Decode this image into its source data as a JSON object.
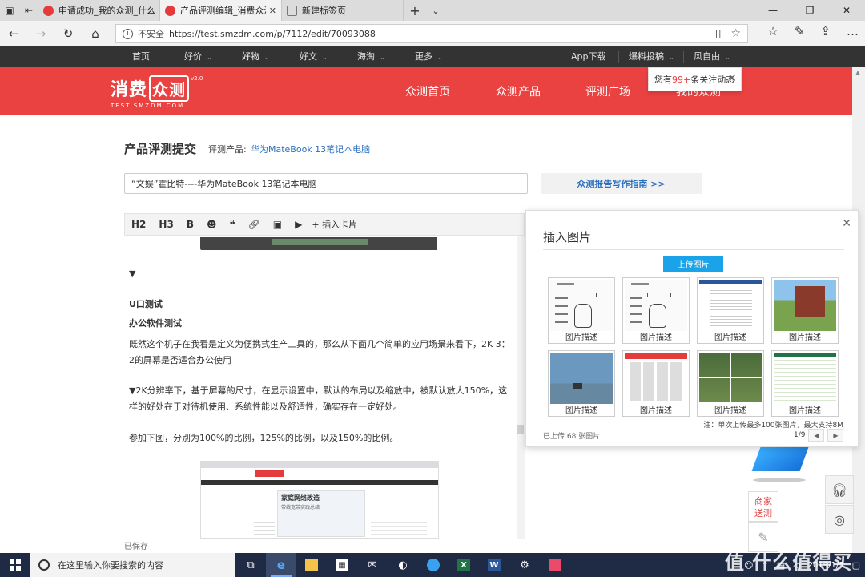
{
  "browser": {
    "tabs": [
      {
        "title": "申请成功_我的众测_什么值",
        "active": false
      },
      {
        "title": "产品评测编辑_消费众测",
        "active": true
      },
      {
        "title": "新建标签页",
        "active": false
      }
    ],
    "insecure_label": "不安全",
    "url": "https://test.smzdm.com/p/7112/edit/70093088"
  },
  "site_nav": {
    "items": [
      "首页",
      "好价",
      "好物",
      "好文",
      "海淘",
      "更多"
    ],
    "right_items": [
      "App下载",
      "爆料投稿",
      "风自由"
    ]
  },
  "hero": {
    "logo_text_a": "消费",
    "logo_text_b": "众测",
    "logo_version": "v2.0",
    "logo_sub": "TEST.SMZDM.COM",
    "nav": [
      "众测首页",
      "众测产品",
      "评测广场",
      "我的众测"
    ]
  },
  "notification": {
    "prefix": "您有",
    "count": "99+",
    "suffix": "条关注动态"
  },
  "page": {
    "heading": "产品评测提交",
    "product_label": "评测产品:",
    "product_name": "华为MateBook 13笔记本电脑",
    "title_value": "“文娱”霍比特----华为MateBook 13笔记本电脑",
    "guide_button": "众测报告写作指南 >>",
    "saved_status": "已保存"
  },
  "toolbar": {
    "h2": "H2",
    "h3": "H3",
    "bold": "B",
    "insert_card": "插入卡片"
  },
  "editor": {
    "arrow": "▼",
    "h_usb": "U口测试",
    "h_office": "办公软件测试",
    "p1": "既然这个机子在我看是定义为便携式生产工具的，那么从下面几个简单的应用场景来看下，2K 3：2的屏幕是否适合办公使用",
    "p2": "▼2K分辨率下，基于屏幕的尺寸，在显示设置中，默认的布局以及缩放中，被默认放大150%，这样的好处在于对待机使用、系统性能以及舒适性，确实存在一定好处。",
    "p3": "参加下图，分别为100%的比例，125%的比例，以及150%的比例。",
    "screenshot_banner_title": "家庭网络改造",
    "screenshot_banner_sub": "带线宽带实践总结"
  },
  "image_panel": {
    "title": "插入图片",
    "upload_button": "上传图片",
    "thumb_caption": "图片描述",
    "note": "注：单次上传最多100张图片，最大支持8M",
    "uploaded_count": "已上传 68 张图片",
    "page_indicator": "1/9"
  },
  "float": {
    "merchant_line1": "商家",
    "merchant_line2": "送测"
  },
  "taskbar": {
    "search_placeholder": "在这里输入你要搜索的内容",
    "time": "",
    "date": "2019/1/5",
    "watermark": "值 什么值得买"
  },
  "colors": {
    "brand_red": "#ea4141",
    "link_blue": "#2a6fbe",
    "upload_blue": "#1aa3e8",
    "taskbar": "#1f2a44"
  }
}
